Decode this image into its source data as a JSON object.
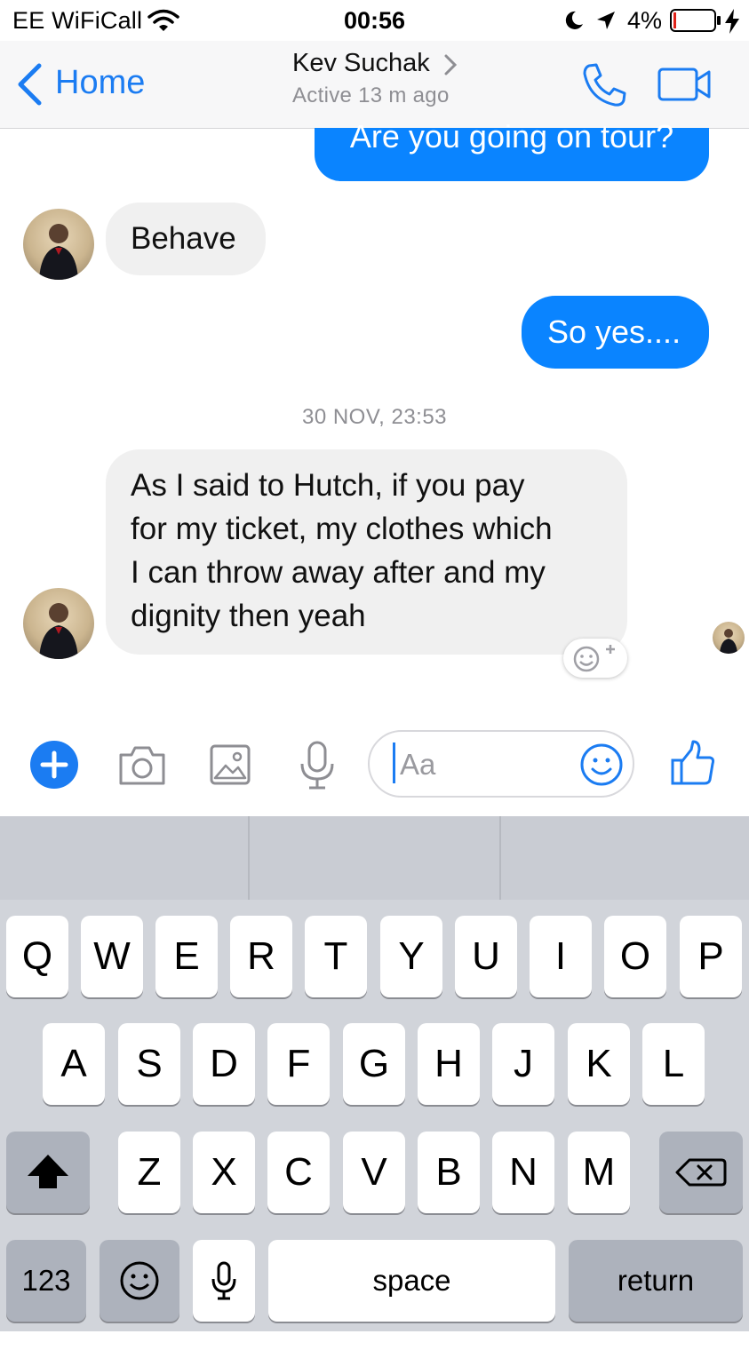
{
  "status_bar": {
    "carrier": "EE WiFiCall",
    "time": "00:56",
    "battery_percent": "4%"
  },
  "header": {
    "back_label": "Home",
    "contact_name": "Kev Suchak",
    "active_status": "Active 13 m ago"
  },
  "messages": [
    {
      "direction": "outgoing",
      "text": "Are you going on tour?"
    },
    {
      "direction": "incoming",
      "text": "Behave"
    },
    {
      "direction": "outgoing",
      "text": "So yes...."
    },
    {
      "direction": "incoming",
      "lines": [
        "As I said to Hutch, if you pay",
        "for my ticket, my clothes which",
        "I can throw away after and my",
        "dignity then yeah"
      ]
    }
  ],
  "timestamp": "30 NOV, 23:53",
  "composer": {
    "placeholder": "Aa",
    "icons": [
      "plus-icon",
      "camera-icon",
      "image-icon",
      "microphone-icon",
      "emoji-icon",
      "thumbs-up-icon"
    ]
  },
  "keyboard": {
    "row1": [
      "Q",
      "W",
      "E",
      "R",
      "T",
      "Y",
      "U",
      "I",
      "O",
      "P"
    ],
    "row2": [
      "A",
      "S",
      "D",
      "F",
      "G",
      "H",
      "J",
      "K",
      "L"
    ],
    "row3": [
      "Z",
      "X",
      "C",
      "V",
      "B",
      "N",
      "M"
    ],
    "numbers_label": "123",
    "space_label": "space",
    "return_label": "return"
  },
  "colors": {
    "accent": "#1b7cf2",
    "outgoing_bubble": "#0a84ff",
    "incoming_bubble": "#f0f0f0",
    "keyboard_bg": "#d1d4da"
  }
}
